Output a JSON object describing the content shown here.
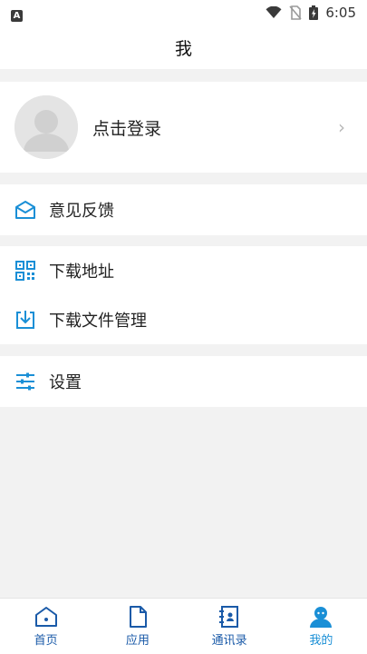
{
  "status_bar": {
    "time": "6:05",
    "notification_icon": "A"
  },
  "header": {
    "title": "我"
  },
  "profile": {
    "login_label": "点击登录",
    "chevron": "›"
  },
  "menu": {
    "feedback": "意见反馈",
    "download_address": "下载地址",
    "download_manager": "下载文件管理",
    "settings": "设置"
  },
  "nav": {
    "home": "首页",
    "apps": "应用",
    "contacts": "通讯录",
    "mine": "我的"
  },
  "colors": {
    "accent": "#1a8fd6",
    "nav_text": "#1a5aa8",
    "background": "#f2f2f2"
  }
}
